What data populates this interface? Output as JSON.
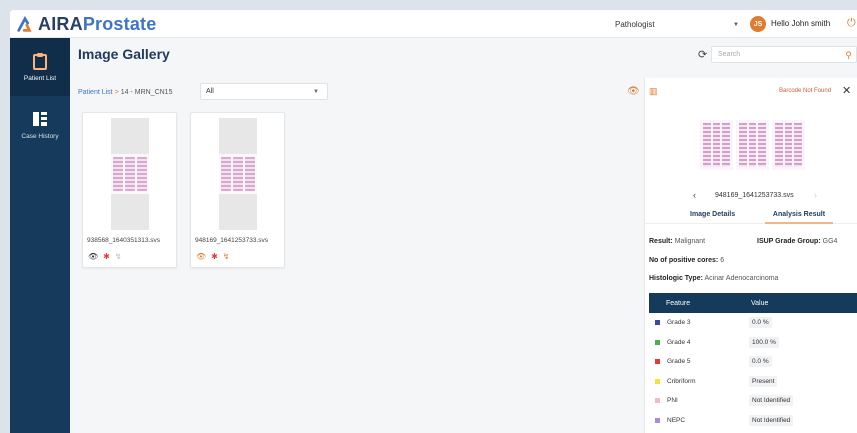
{
  "app": {
    "brand_main": "AIRA",
    "brand_accent": "Prostate"
  },
  "header": {
    "role": "Pathologist",
    "avatar_initials": "JS",
    "greeting": "Hello John smith"
  },
  "sidebar": {
    "items": [
      {
        "label": "Patient List",
        "icon": "clipboard-icon"
      },
      {
        "label": "Case History",
        "icon": "history-icon"
      }
    ]
  },
  "page": {
    "title": "Image Gallery",
    "search_placeholder": "Search"
  },
  "breadcrumb": {
    "root": "Patient List",
    "sep": ">",
    "current": "14 - MRN_CN15"
  },
  "filter": {
    "selected": "All"
  },
  "cards": [
    {
      "name": "938568_1640351313.svs"
    },
    {
      "name": "948169_1641253733.svs"
    }
  ],
  "panel": {
    "barcode_status": "Barcode Not Found",
    "file_name": "948169_1641253733.svs",
    "tabs": [
      "Image Details",
      "Analysis Result"
    ],
    "result_label": "Result:",
    "result_value": "Malignant",
    "isup_label": "ISUP Grade Group:",
    "isup_value": "GG4",
    "cores_label": "No of positive cores:",
    "cores_value": "6",
    "histo_label": "Histologic Type:",
    "histo_value": "Acinar Adenocarcinoma",
    "table_headers": [
      "Feature",
      "Value"
    ],
    "features": [
      {
        "name": "Grade 3",
        "value": "0.0 %",
        "color": "#3b4a9e"
      },
      {
        "name": "Grade 4",
        "value": "100.0 %",
        "color": "#4caf50"
      },
      {
        "name": "Grade 5",
        "value": "0.0 %",
        "color": "#e53935"
      },
      {
        "name": "Cribriform",
        "value": "Present",
        "color": "#f2e23a"
      },
      {
        "name": "PNI",
        "value": "Not Identified",
        "color": "#f2b8cf"
      },
      {
        "name": "NEPC",
        "value": "Not Identified",
        "color": "#a98ed6"
      }
    ]
  },
  "colors": {
    "navy": "#163a5c",
    "accent": "#e07b2f",
    "link": "#3d74c9"
  }
}
